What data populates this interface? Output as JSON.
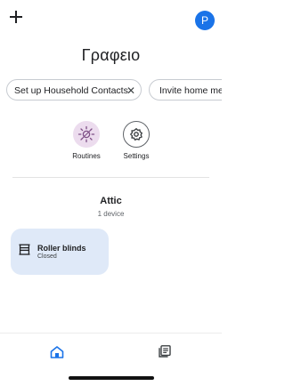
{
  "header": {
    "avatar_initial": "P",
    "home_name": "Γραφειο"
  },
  "chips": [
    {
      "label": "Set up Household Contacts",
      "close_glyph": "✕"
    },
    {
      "label": "Invite home mem"
    }
  ],
  "actions": [
    {
      "label": "Routines",
      "icon": "routines-sun-icon"
    },
    {
      "label": "Settings",
      "icon": "gear-icon"
    }
  ],
  "room": {
    "name": "Attic",
    "count": "1 device"
  },
  "devices": [
    {
      "name": "Roller blinds",
      "status": "Closed",
      "icon": "blinds-icon"
    }
  ],
  "nav": [
    {
      "icon": "home-icon",
      "active": true
    },
    {
      "icon": "list-document-icon",
      "active": false
    }
  ],
  "colors": {
    "accent": "#1a73e8",
    "routines_bg": "#ecdcee",
    "device_card_bg": "#dfe9f8"
  }
}
